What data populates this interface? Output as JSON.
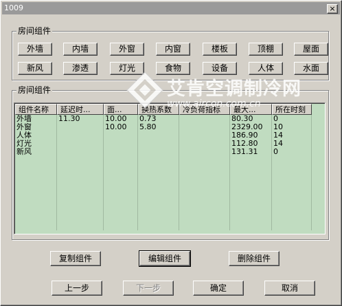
{
  "window": {
    "title": "1009",
    "close_glyph": "×"
  },
  "top_group": {
    "label": "房间组件",
    "buttons": [
      "外墙",
      "内墙",
      "外窗",
      "内窗",
      "楼板",
      "顶棚",
      "屋面",
      "新风",
      "渗透",
      "灯光",
      "食物",
      "设备",
      "人体",
      "水面"
    ]
  },
  "table_group": {
    "label": "房间组件",
    "columns": [
      "组件名称",
      "延迟时...",
      "面...",
      "换热系数",
      "冷负荷指标",
      "最大...",
      "所在时刻"
    ],
    "rows": [
      [
        "外墙",
        "11.30",
        "10.00",
        "0.73",
        "",
        "80.30",
        "0"
      ],
      [
        "外窗",
        "",
        "10.00",
        "5.80",
        "",
        "2329.00",
        "10"
      ],
      [
        "人体",
        "",
        "",
        "",
        "",
        "186.90",
        "14"
      ],
      [
        "灯光",
        "",
        "",
        "",
        "",
        "112.80",
        "14"
      ],
      [
        "新风",
        "",
        "",
        "",
        "",
        "131.31",
        "0"
      ]
    ]
  },
  "actions": {
    "copy": "复制组件",
    "edit": "编辑组件",
    "delete": "删除组件"
  },
  "nav": {
    "prev": "上一步",
    "next": "下一步",
    "ok": "确定",
    "cancel": "取消"
  },
  "watermark": {
    "text": "艾肯空调制冷网",
    "url": "www.aircon.com.cn",
    "icon": "aircon-logo-icon"
  }
}
